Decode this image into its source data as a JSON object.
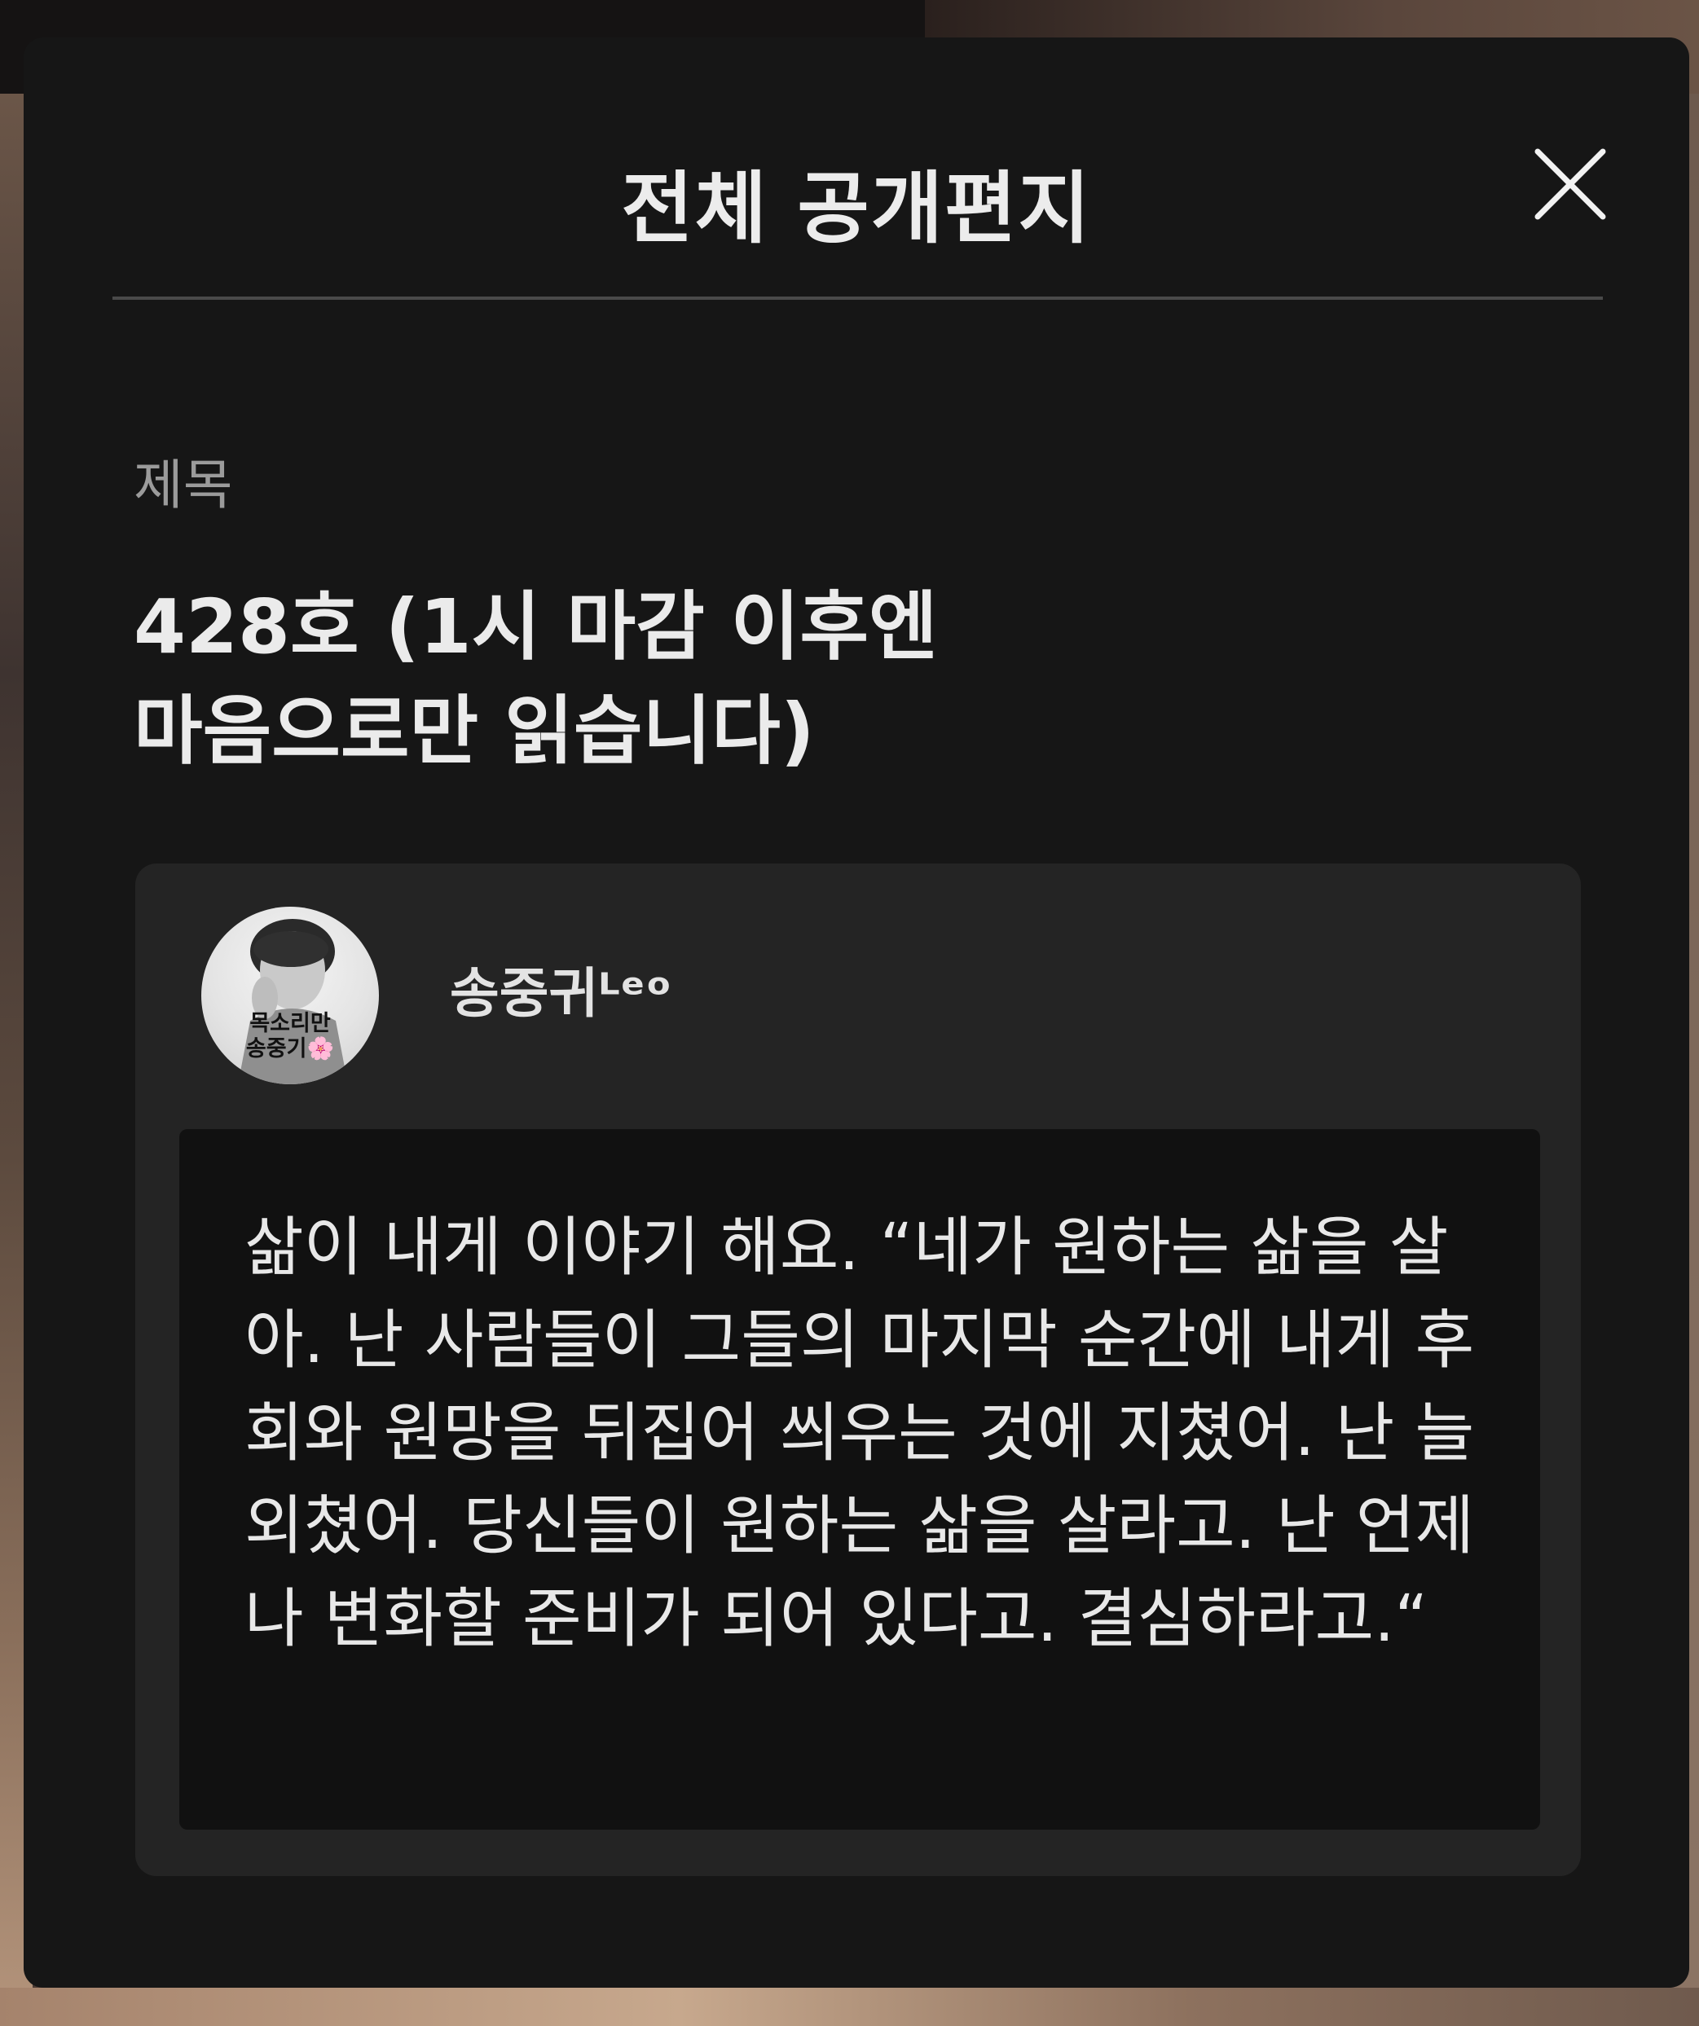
{
  "modal": {
    "title": "전체 공개편지",
    "close_icon": "close-icon"
  },
  "subject": {
    "label": "제목",
    "text": "428호 (1시 마감 이후엔\n마음으로만 읽습니다)"
  },
  "letter": {
    "author_name": "송중귀ᴸᵉᵒ",
    "avatar_caption_line1": "목소리만",
    "avatar_caption_line2": "송중기🌸",
    "body": "삶이 내게 이야기 해요. “네가 원하는 삶을 살아. 난 사람들이 그들의 마지막 순간에 내게 후회와 원망을 뒤집어 씌우는 것에 지쳤어. 난 늘 외쳤어. 당신들이 원하는 삶을 살라고. 난 언제나 변화할 준비가 되어 있다고. 결심하라고.“"
  },
  "colors": {
    "modal_bg": "#161616",
    "card_bg": "#242424",
    "body_box_bg": "#111111",
    "title_text": "#ececec",
    "label_text": "#9b9b9b"
  }
}
